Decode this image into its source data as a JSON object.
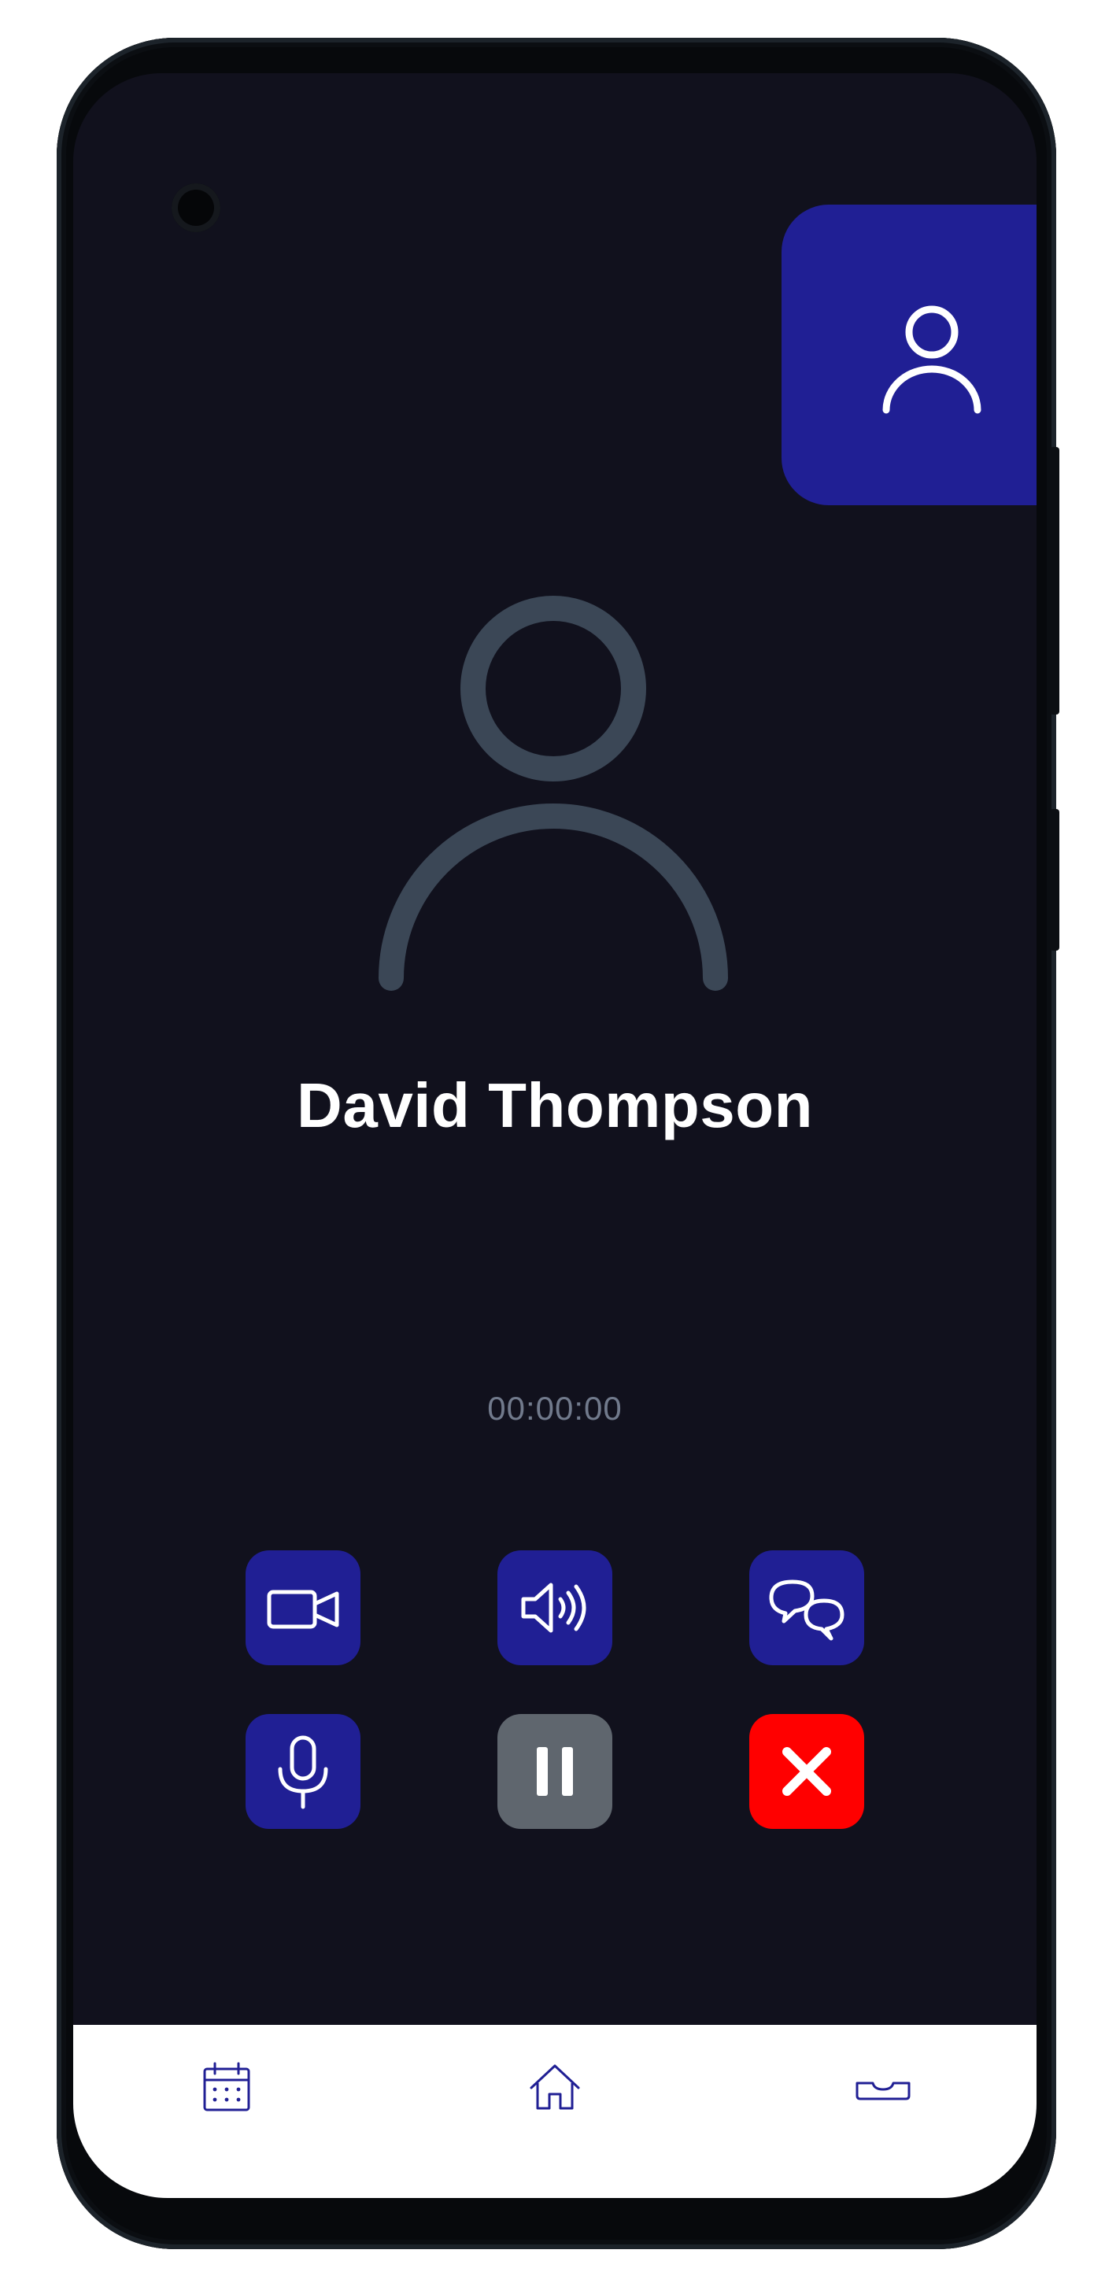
{
  "call": {
    "caller_name": "David Thompson",
    "timer": "00:00:00"
  },
  "self_view": {
    "icon": "user-icon"
  },
  "controls": {
    "video": {
      "icon": "video-camera-icon"
    },
    "speaker": {
      "icon": "speaker-icon"
    },
    "chat": {
      "icon": "chat-bubbles-icon"
    },
    "mute": {
      "icon": "microphone-icon"
    },
    "hold": {
      "icon": "pause-icon"
    },
    "end_call": {
      "icon": "close-icon"
    }
  },
  "bottom_nav": {
    "items": [
      {
        "icon": "calendar-icon"
      },
      {
        "icon": "home-icon"
      },
      {
        "icon": "inbox-tray-icon"
      }
    ]
  },
  "colors": {
    "screen_background": "#11111d",
    "accent": "#201f94",
    "end_call": "#ff0000",
    "hold": "#5f666e",
    "avatar_outline": "#3b4756",
    "timer_text": "#717a8c",
    "nav_icon": "#201f94"
  }
}
